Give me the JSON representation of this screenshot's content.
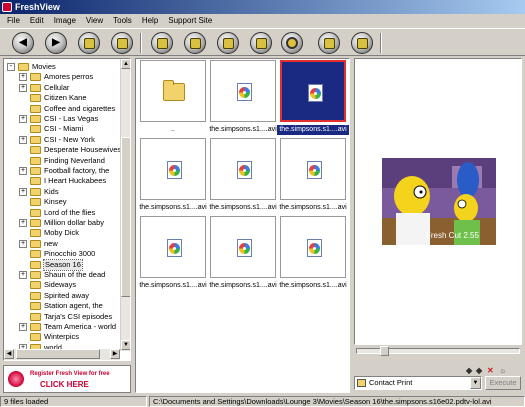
{
  "window": {
    "title": "FreshView"
  },
  "menu": [
    "File",
    "Edit",
    "Image",
    "View",
    "Tools",
    "Help",
    "Support Site"
  ],
  "toolbar": {
    "buttons": [
      "back-icon",
      "forward-icon",
      "copy-icon",
      "move-icon",
      "slideshow-icon",
      "wallpaper-icon",
      "print-icon",
      "rotate-icon",
      "email-icon",
      "export-icon",
      "properties-icon"
    ]
  },
  "tree": {
    "items": [
      {
        "label": "Movies",
        "expander": "-"
      },
      {
        "label": "Amores perros",
        "expander": "+"
      },
      {
        "label": "Cellular",
        "expander": "+"
      },
      {
        "label": "Citizen Kane",
        "expander": ""
      },
      {
        "label": "Coffee and cigarettes",
        "expander": ""
      },
      {
        "label": "CSI - Las Vegas",
        "expander": "+"
      },
      {
        "label": "CSI - Miami",
        "expander": ""
      },
      {
        "label": "CSI - New York",
        "expander": "+"
      },
      {
        "label": "Desperate Housewives",
        "expander": ""
      },
      {
        "label": "Finding Neverland",
        "expander": ""
      },
      {
        "label": "Football factory, the",
        "expander": "+"
      },
      {
        "label": "I Heart Huckabees",
        "expander": ""
      },
      {
        "label": "Kids",
        "expander": "+"
      },
      {
        "label": "Kinsey",
        "expander": ""
      },
      {
        "label": "Lord of the flies",
        "expander": ""
      },
      {
        "label": "Million dollar baby",
        "expander": "+"
      },
      {
        "label": "Moby Dick",
        "expander": ""
      },
      {
        "label": "new",
        "expander": "+"
      },
      {
        "label": "Pinocchio 3000",
        "expander": ""
      },
      {
        "label": "Season 16",
        "expander": "",
        "selected": true
      },
      {
        "label": "Shaun of the dead",
        "expander": "+"
      },
      {
        "label": "Sideways",
        "expander": ""
      },
      {
        "label": "Spirited away",
        "expander": ""
      },
      {
        "label": "Station agent, the",
        "expander": ""
      },
      {
        "label": "Tarja's CSI episodes",
        "expander": ""
      },
      {
        "label": "Team America - world",
        "expander": "+"
      },
      {
        "label": "Winterpics",
        "expander": ""
      },
      {
        "label": "world",
        "expander": "+"
      }
    ]
  },
  "ad": {
    "line1": "Register Fresh View for free",
    "line2": "CLICK HERE"
  },
  "thumbnails": [
    {
      "caption": "..",
      "kind": "folder"
    },
    {
      "caption": "the.simpsons.s1....avi",
      "kind": "video"
    },
    {
      "caption": "the.simpsons.s1....avi",
      "kind": "video",
      "selected": true
    },
    {
      "caption": "the.simpsons.s1....avi",
      "kind": "video"
    },
    {
      "caption": "the.simpsons.s1....avi",
      "kind": "video"
    },
    {
      "caption": "the.simpsons.s1....avi",
      "kind": "video"
    },
    {
      "caption": "the.simpsons.s1....avi",
      "kind": "video"
    },
    {
      "caption": "the.simpsons.s1....avi",
      "kind": "video"
    },
    {
      "caption": "the.simpsons.s1....avi",
      "kind": "video"
    }
  ],
  "preview": {
    "caption_on_frame": "Fresh Cut 2.55"
  },
  "action": {
    "selected": "Contact Print",
    "execute_label": "Execute"
  },
  "status": {
    "count": "9 files loaded",
    "path": "C:\\Documents and Settings\\Downloads\\Lounge 3\\Movies\\Season 16\\the.simpsons.s16e02.pdtv-lol.avi"
  },
  "colors": {
    "titlebar": "#0a246a",
    "selection": "#1a2a82",
    "selection_border": "#e23030",
    "folder": "#f2d36b"
  }
}
